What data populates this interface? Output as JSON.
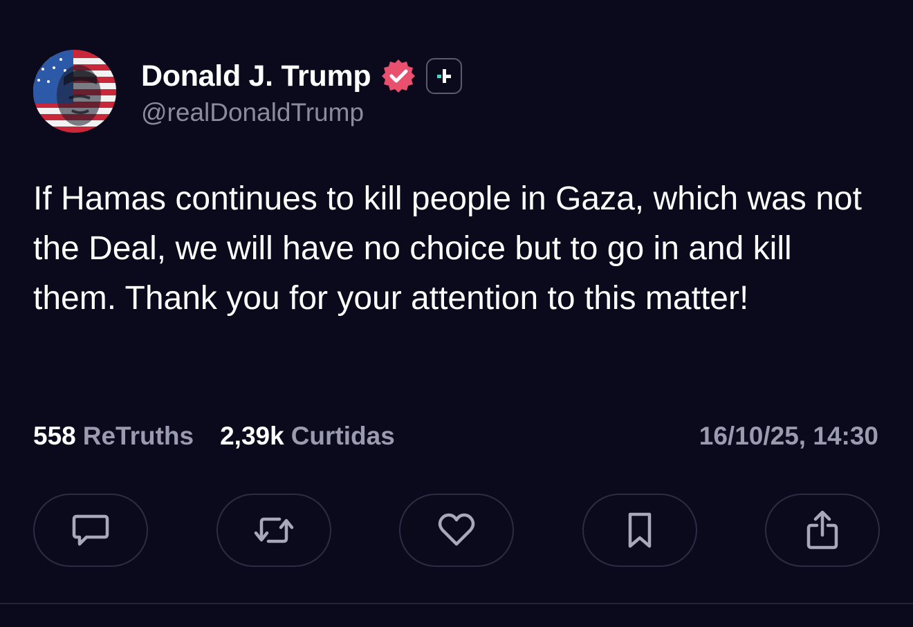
{
  "post": {
    "display_name": "Donald J. Trump",
    "handle": "@realDonaldTrump",
    "text": "If Hamas continues to kill people in Gaza, which was not the Deal, we will have no choice but to go in and kill them. Thank you for your attention to this matter!",
    "retruths_count": "558",
    "retruths_label": "ReTruths",
    "likes_count": "2,39k",
    "likes_label": "Curtidas",
    "timestamp": "16/10/25, 14:30"
  },
  "icons": {
    "verified": "verified-badge-icon",
    "plus": "plus-badge-icon",
    "reply": "comment-icon",
    "retruth": "repost-icon",
    "like": "heart-icon",
    "bookmark": "bookmark-icon",
    "share": "share-icon"
  },
  "colors": {
    "background": "#0b0a1c",
    "verified": "#e8506e",
    "secondary_text": "#9a9ab0",
    "button_border": "#2c2c44"
  }
}
